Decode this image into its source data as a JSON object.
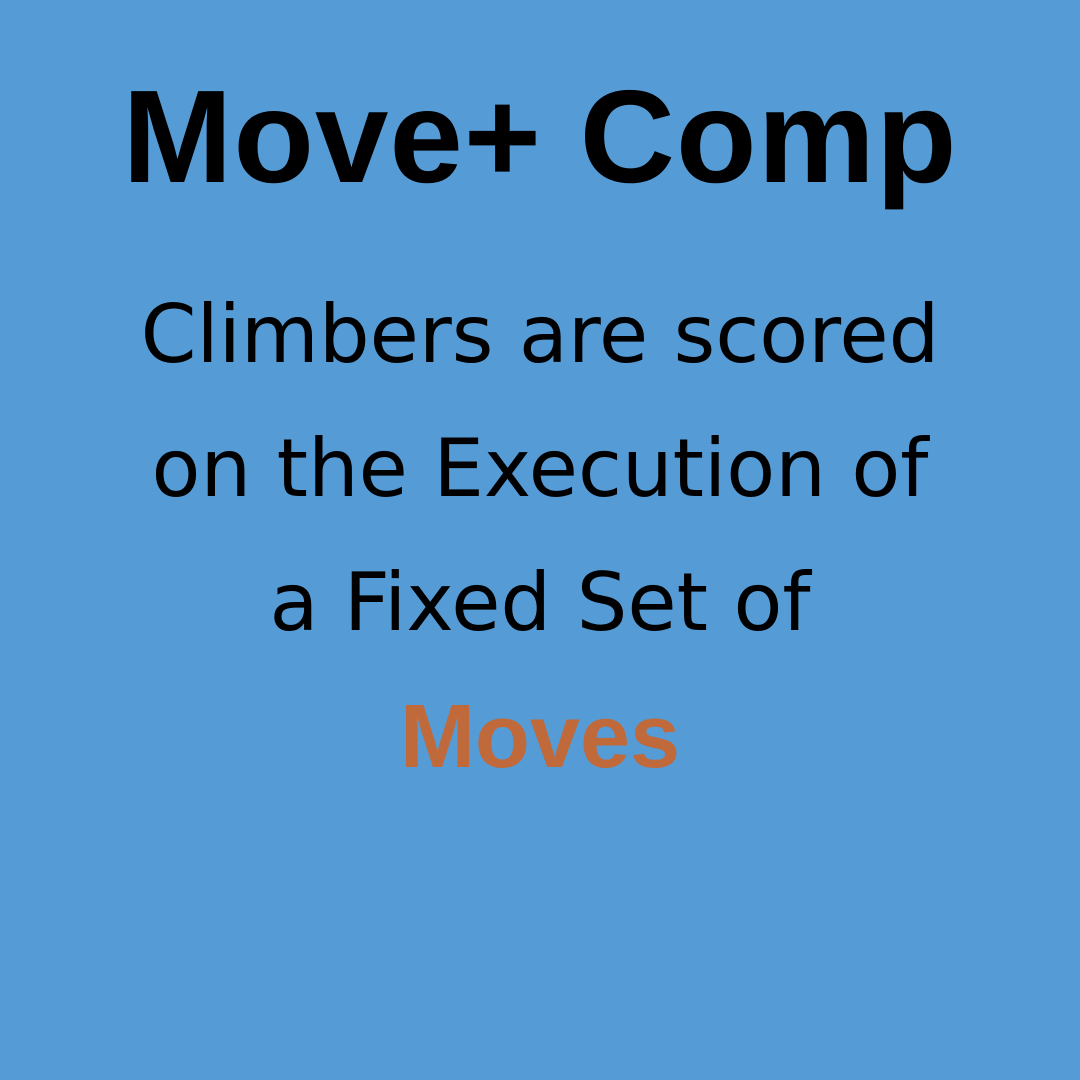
{
  "title": "Move+ Comp",
  "body": {
    "lines": [
      "Climbers are scored",
      "on the Execution of",
      "a Fixed Set of"
    ],
    "highlight": "Moves"
  },
  "colors": {
    "background": "#559bd6",
    "text": "#000000",
    "highlight": "#c0693a"
  }
}
